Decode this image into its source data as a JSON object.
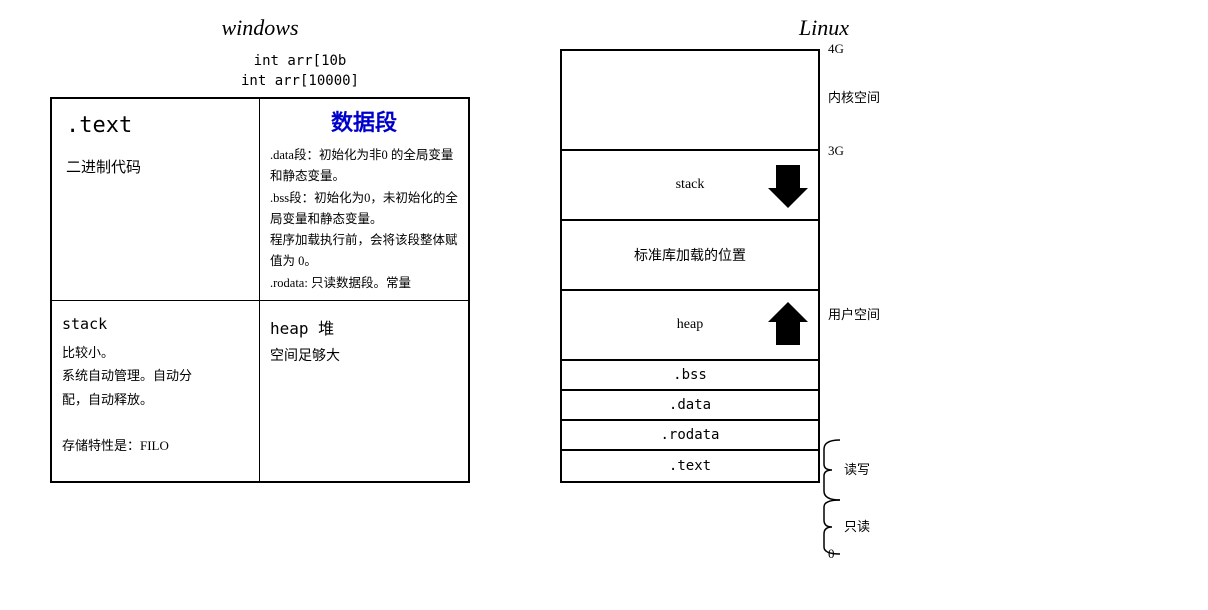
{
  "windows": {
    "title": "windows",
    "code_lines": [
      "int arr[10b",
      "int arr[10000]"
    ],
    "cells": {
      "top_left": {
        "label": ".text",
        "desc": "二进制代码"
      },
      "top_right": {
        "title": "数据段",
        "lines": [
          ".data段：初始化为非0 的全局变量和静态变量。",
          ".bss段：初始化为0，未初始化的全局变量和静态变量。",
          "        程序加载执行前，会将该段整体赋值为 0。",
          ".rodata: 只读数据段。常量"
        ]
      },
      "bottom_left": {
        "title": "stack",
        "desc": "比较小。\n系统自动管理。自动分\n配，自动释放。\n\n存储特性是：FILO"
      },
      "bottom_right": {
        "title": "heap 堆",
        "desc": "空间足够大"
      }
    }
  },
  "linux": {
    "title": "Linux",
    "blocks": [
      {
        "id": "kernel",
        "label": ""
      },
      {
        "id": "stack",
        "label": "stack"
      },
      {
        "id": "stdlib",
        "label": "标准库加载的位置"
      },
      {
        "id": "heap",
        "label": "heap"
      },
      {
        "id": "bss",
        "label": ".bss"
      },
      {
        "id": "data",
        "label": ".data"
      },
      {
        "id": "rodata",
        "label": ".rodata"
      },
      {
        "id": "text",
        "label": ".text"
      }
    ],
    "labels": {
      "top": "4G",
      "label_3g": "3G",
      "kernel_space": "内核空间",
      "user_space": "用户空间",
      "readwrite": "读写",
      "readonly": "只读",
      "zero": "0"
    }
  }
}
